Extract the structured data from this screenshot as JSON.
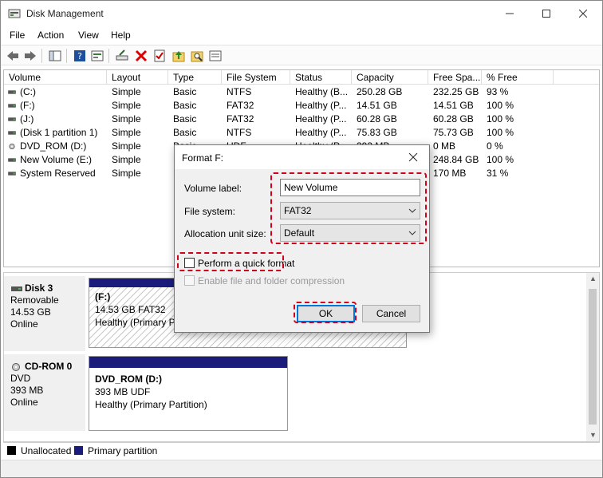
{
  "window": {
    "title": "Disk Management"
  },
  "menu": [
    "File",
    "Action",
    "View",
    "Help"
  ],
  "list": {
    "columns": [
      "Volume",
      "Layout",
      "Type",
      "File System",
      "Status",
      "Capacity",
      "Free Spa...",
      "% Free"
    ],
    "rows": [
      [
        "(C:)",
        "Simple",
        "Basic",
        "NTFS",
        "Healthy (B...",
        "250.28 GB",
        "232.25 GB",
        "93 %"
      ],
      [
        "(F:)",
        "Simple",
        "Basic",
        "FAT32",
        "Healthy (P...",
        "14.51 GB",
        "14.51 GB",
        "100 %"
      ],
      [
        "(J:)",
        "Simple",
        "Basic",
        "FAT32",
        "Healthy (P...",
        "60.28 GB",
        "60.28 GB",
        "100 %"
      ],
      [
        "(Disk 1 partition 1)",
        "Simple",
        "Basic",
        "NTFS",
        "Healthy (P...",
        "75.83 GB",
        "75.73 GB",
        "100 %"
      ],
      [
        "DVD_ROM (D:)",
        "Simple",
        "Basic",
        "UDF",
        "Healthy (P...",
        "393 MB",
        "0 MB",
        "0 %"
      ],
      [
        "New Volume (E:)",
        "Simple",
        "B",
        "",
        "",
        "",
        "248.84 GB",
        "100 %"
      ],
      [
        "System Reserved",
        "Simple",
        "B",
        "",
        "",
        "",
        "170 MB",
        "31 %"
      ]
    ]
  },
  "disks": [
    {
      "name": "Disk 3",
      "type": "Removable",
      "size": "14.53 GB",
      "status": "Online",
      "partition": {
        "title": "(F:)",
        "line1": "14.53 GB FAT32",
        "line2": "Healthy (Primary Pa"
      }
    },
    {
      "name": "CD-ROM 0",
      "type": "DVD",
      "size": "393 MB",
      "status": "Online",
      "partition": {
        "title": "DVD_ROM  (D:)",
        "line1": "393 MB UDF",
        "line2": "Healthy (Primary Partition)"
      }
    }
  ],
  "legend": {
    "unallocated": "Unallocated",
    "primary": "Primary partition",
    "unallocated_color": "#000000",
    "primary_color": "#1b1b7c"
  },
  "dialog": {
    "title": "Format F:",
    "volume_label_caption": "Volume label:",
    "volume_label_value": "New Volume",
    "file_system_caption": "File system:",
    "file_system_value": "FAT32",
    "alloc_caption": "Allocation unit size:",
    "alloc_value": "Default",
    "quick_format": "Perform a quick format",
    "compression": "Enable file and folder compression",
    "ok": "OK",
    "cancel": "Cancel"
  },
  "colors": {
    "highlight": "#d0021b",
    "focus": "#0078d7"
  }
}
